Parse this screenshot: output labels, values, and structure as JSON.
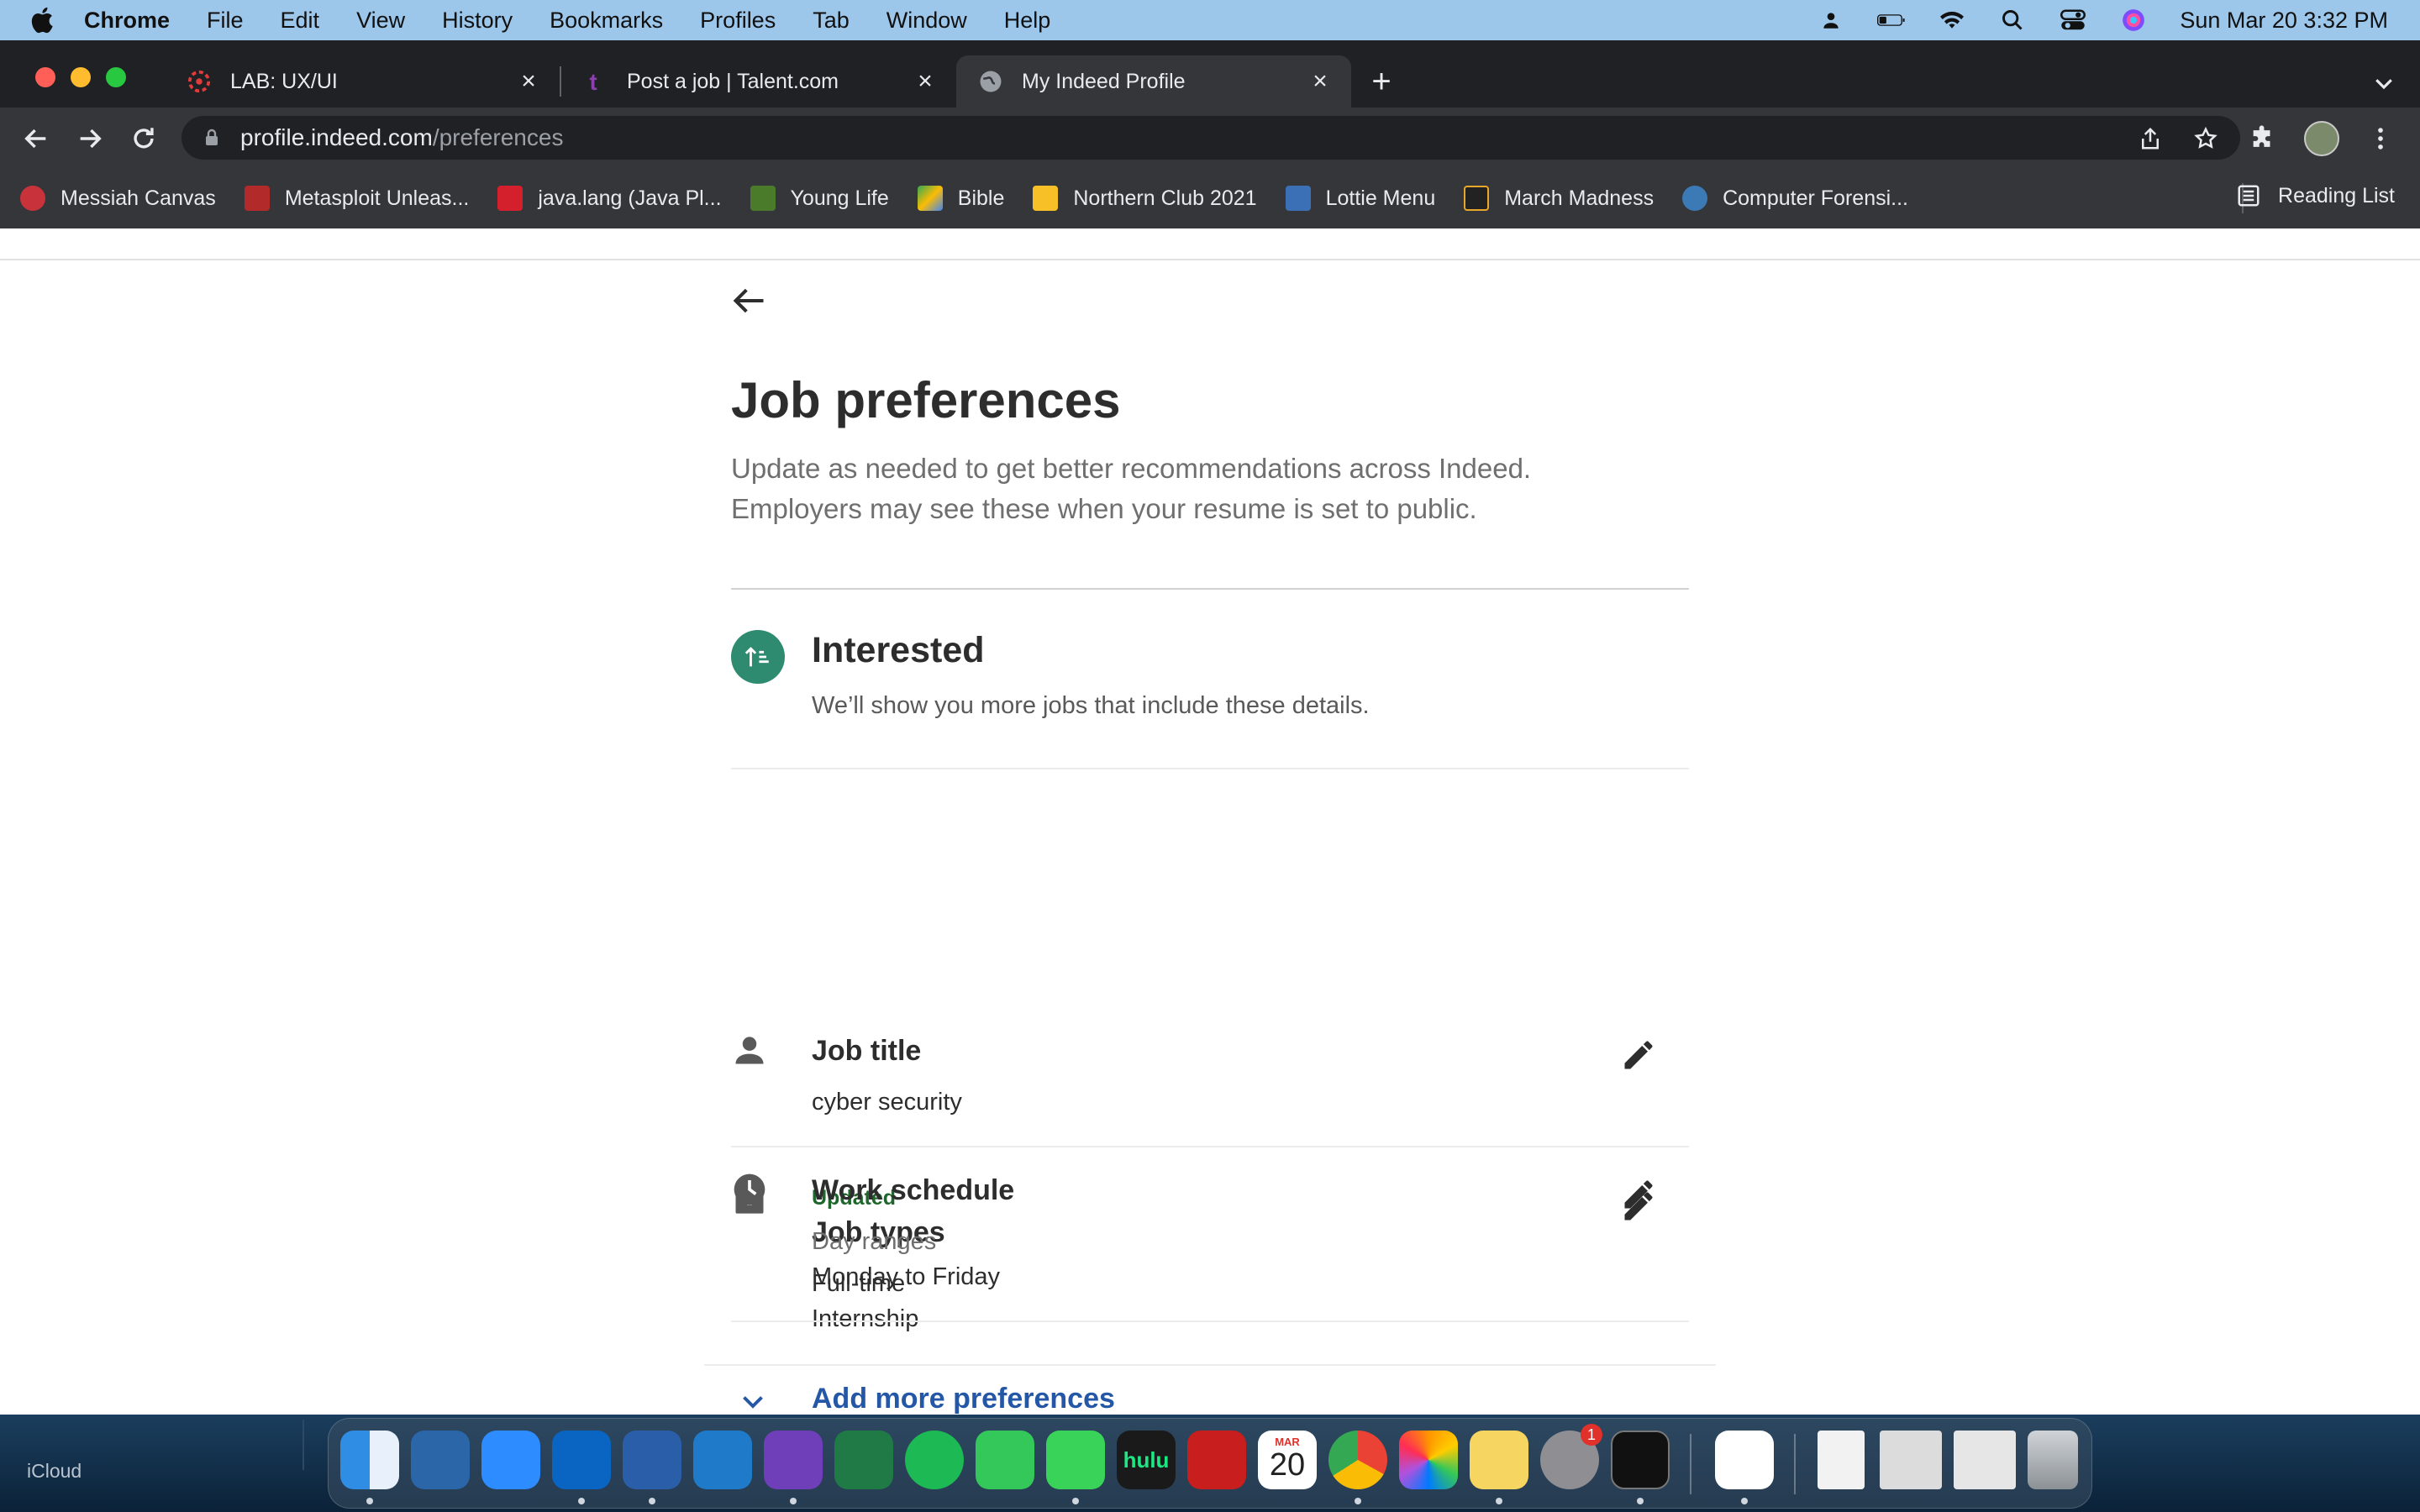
{
  "menubar": {
    "app": "Chrome",
    "items": [
      "File",
      "Edit",
      "View",
      "History",
      "Bookmarks",
      "Profiles",
      "Tab",
      "Window",
      "Help"
    ],
    "clock": "Sun Mar 20  3:32 PM"
  },
  "browser": {
    "tabs": [
      {
        "title": "LAB: UX/UI",
        "active": false
      },
      {
        "title": "Post a job | Talent.com",
        "active": false
      },
      {
        "title": "My Indeed Profile",
        "active": true
      }
    ],
    "url_host": "profile.indeed.com",
    "url_path": "/preferences",
    "bookmarks": [
      {
        "label": "Messiah Canvas",
        "color": "#c8323a"
      },
      {
        "label": "Metasploit Unleas...",
        "color": "#b22a2a"
      },
      {
        "label": "java.lang (Java Pl...",
        "color": "#d4202c"
      },
      {
        "label": "Young Life",
        "color": "#4a7b2a"
      },
      {
        "label": "Bible",
        "color": "#1e88e5"
      },
      {
        "label": "Northern Club 2021",
        "color": "#f6c026"
      },
      {
        "label": "Lottie Menu",
        "color": "#3b6fb6"
      },
      {
        "label": "March Madness",
        "color": "#222222"
      },
      {
        "label": "Computer Forensi...",
        "color": "#3c7ab5"
      }
    ],
    "reading_list": "Reading List"
  },
  "page": {
    "title": "Job preferences",
    "subtitle_line1": "Update as needed to get better recommendations across Indeed.",
    "subtitle_line2": "Employers may see these when your resume is set to public.",
    "section": {
      "title": "Interested",
      "description": "We’ll show you more jobs that include these details.",
      "icon_color": "#2e8b70"
    },
    "job_title": {
      "label": "Job title",
      "value": "cyber security"
    },
    "job_types": {
      "status": "Updated",
      "label": "Job types",
      "values": [
        "Full-time",
        "Internship"
      ]
    },
    "work_schedule": {
      "label": "Work schedule",
      "sublabel": "Day ranges",
      "value": "Monday to Friday"
    },
    "add_more": "Add more preferences"
  },
  "desktop": {
    "icloud_label": "iCloud",
    "dock_apps": [
      "Finder",
      "VirtualBox",
      "Zoom",
      "Outlook",
      "Word",
      "VS Code",
      "GitHub Desktop",
      "Excel",
      "Spotify",
      "FaceTime",
      "Messages",
      "Hulu",
      "Acrobat",
      "Calendar",
      "Chrome",
      "Photos",
      "Notes",
      "System Preferences",
      "Terminal",
      "Slack"
    ],
    "calendar_month": "MAR",
    "calendar_day": "20",
    "settings_badge": "1",
    "hulu_label": "hulu"
  }
}
